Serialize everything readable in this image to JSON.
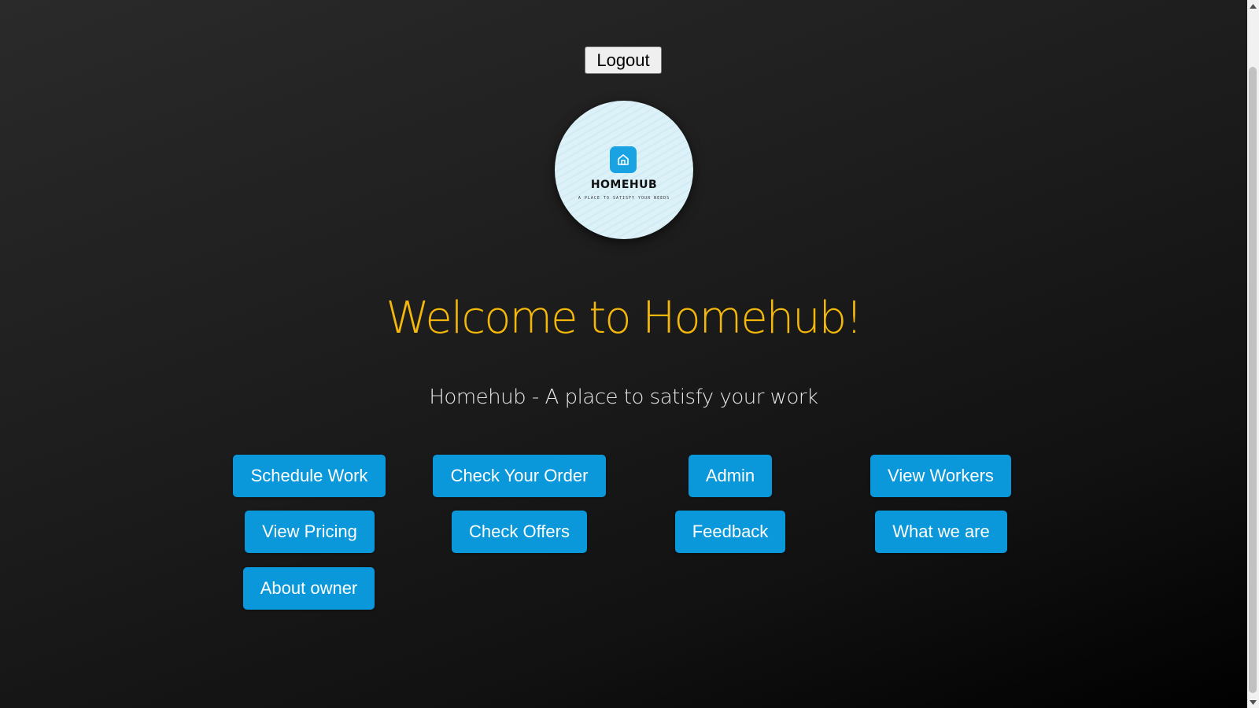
{
  "header": {
    "logout_label": "Logout"
  },
  "logo": {
    "icon": "home-icon",
    "name": "HOMEHUB",
    "tagline": "A PLACE TO SATISFY YOUR NEEDS",
    "accent_color": "#1aa3e3"
  },
  "main": {
    "title": "Welcome to Homehub!",
    "subtitle": "Homehub - A place to satisfy your work",
    "title_color": "#f5b80a",
    "button_color": "#0a98da",
    "buttons": [
      {
        "label": "Schedule Work"
      },
      {
        "label": "Check Your Order"
      },
      {
        "label": "Admin"
      },
      {
        "label": "View Workers"
      },
      {
        "label": "View Pricing"
      },
      {
        "label": "Check Offers"
      },
      {
        "label": "Feedback"
      },
      {
        "label": "What we are"
      },
      {
        "label": "About owner"
      }
    ]
  }
}
